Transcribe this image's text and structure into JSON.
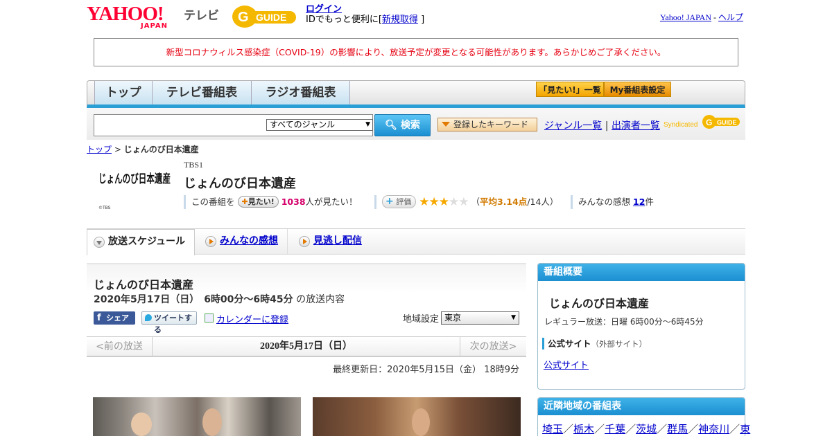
{
  "header": {
    "logo_yahoo": "YAHOO!",
    "logo_japan": "JAPAN",
    "logo_tv": "テレビ",
    "logo_gguide": "GUIDE",
    "login": "ログイン",
    "login_sub_prefix": "IDでもっと便利に[",
    "register": "新規取得",
    "login_sub_suffix": "]",
    "yahoo_japan": "Yahoo! JAPAN",
    "separator": "-",
    "help": "ヘルプ"
  },
  "notice": "新型コロナウィルス感染症（COVID-19）の影響により、放送予定が変更となる可能性があります。あらかじめご了承ください。",
  "nav": {
    "tabs": [
      "トップ",
      "テレビ番組表",
      "ラジオ番組表"
    ],
    "mitai_list": "「見たい!」一覧",
    "my_settings": "My番組表設定"
  },
  "search": {
    "input_value": "",
    "genre_selected": "すべてのジャンル",
    "search_button": "検索",
    "keyword_button": "登録したキーワード",
    "genre_list": "ジャンル一覧",
    "link_sep": "|",
    "performer_list": "出演者一覧",
    "syndicated": "Syndicated"
  },
  "breadcrumb": {
    "top": "トップ",
    "sep": ">",
    "current": "じょんのび日本遺産"
  },
  "program": {
    "logo_text": "じょんのび日本遺産",
    "logo_credit": "©TBS",
    "channel": "TBS1",
    "title": "じょんのび日本遺産",
    "mitai_prefix": "この番組を",
    "mitai_button": "見たい!",
    "mitai_count": "1038",
    "mitai_suffix": "人が見たい！",
    "eval_button": "評価",
    "rating_stars": 3,
    "rating_max": 5,
    "avg_prefix": "（",
    "avg_text": "平均3.14点",
    "avg_count": "/14人）",
    "kanso_prefix": "みんなの感想",
    "kanso_count": "12",
    "kanso_suffix": "件"
  },
  "tabs": {
    "schedule": "放送スケジュール",
    "kanso": "みんなの感想",
    "minogashi": "見逃し配信"
  },
  "broadcast": {
    "title": "じょんのび日本遺産",
    "date_time": "2020年5月17日（日）　6時00分～6時45分",
    "time_suffix": "の放送内容",
    "share_fb": "シェア",
    "share_tw": "ツイートする",
    "calendar": "カレンダーに登録",
    "region_label": "地域設定",
    "region_value": "東京",
    "prev": "<前の放送",
    "current_date": "2020年5月17日（日）",
    "next": "次の放送>",
    "last_update": "最終更新日：2020年5月15日（金）  18時9分"
  },
  "sidebar": {
    "summary_head": "番組概要",
    "summary_title": "じょんのび日本遺産",
    "regular": "レギュラー放送：日曜 6時00分～6時45分",
    "official_head": "公式サイト",
    "official_note": "（外部サイト）",
    "official_link": "公式サイト",
    "nearby_head": "近隣地域の番組表",
    "nearby": [
      "埼玉",
      "栃木",
      "千葉",
      "茨城",
      "群馬",
      "神奈川",
      "東"
    ],
    "nearby_sep": "／"
  },
  "colors": {
    "yahoo_red": "#ff0033",
    "notice_red": "#e60012",
    "accent_blue": "#2a9fd6",
    "star": "#f5a800"
  }
}
